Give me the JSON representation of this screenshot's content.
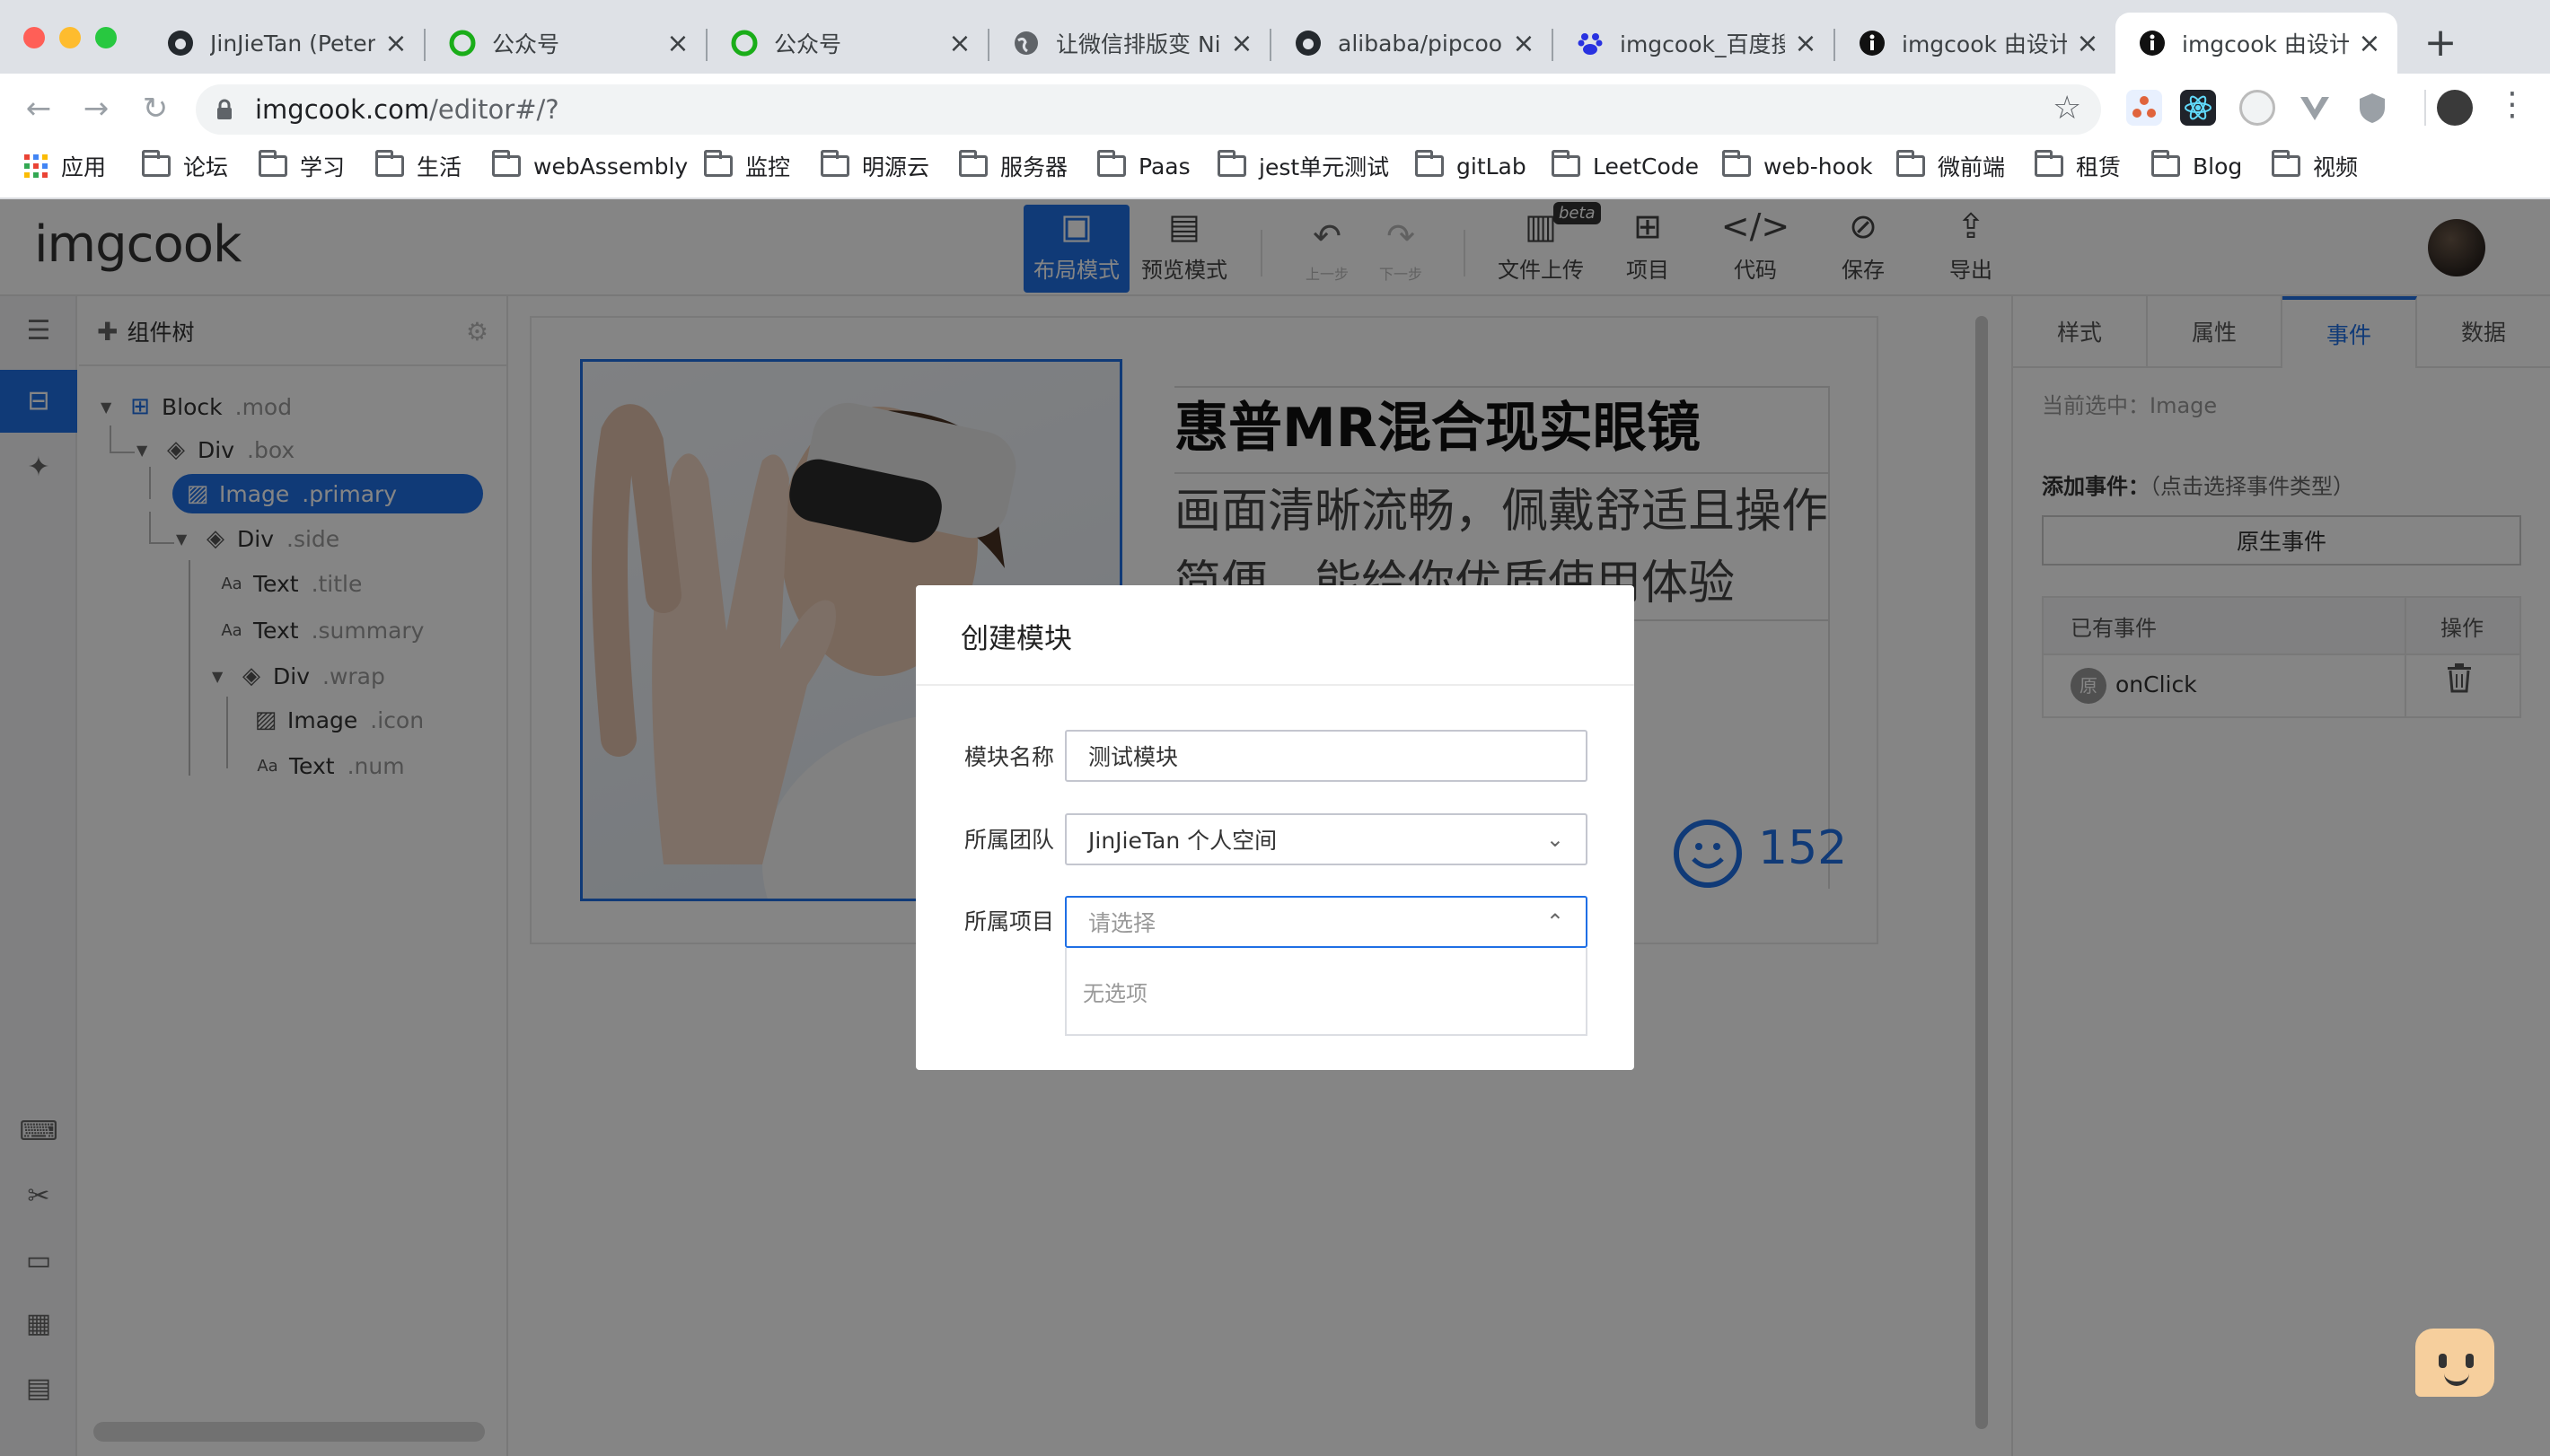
{
  "browser": {
    "tabs": [
      {
        "label": "JinJieTan (Peter)",
        "favicon": "github-icon"
      },
      {
        "label": "公众号",
        "favicon": "wechat-mp-icon"
      },
      {
        "label": "公众号",
        "favicon": "wechat-mp-icon"
      },
      {
        "label": "让微信排版变 Ni",
        "favicon": "globe-icon"
      },
      {
        "label": "alibaba/pipcook",
        "favicon": "github-icon"
      },
      {
        "label": "imgcook_百度搜",
        "favicon": "baidu-icon"
      },
      {
        "label": "imgcook 由设计",
        "favicon": "info-icon"
      },
      {
        "label": "imgcook 由设计",
        "favicon": "info-icon",
        "active": true
      }
    ],
    "url_host": "imgcook.com",
    "url_path": "/editor#/?",
    "bookmarks": [
      "应用",
      "论坛",
      "学习",
      "生活",
      "webAssembly",
      "监控",
      "明源云",
      "服务器",
      "Paas",
      "jest单元测试",
      "gitLab",
      "LeetCode",
      "web-hook",
      "微前端",
      "租赁",
      "Blog",
      "视频"
    ]
  },
  "app": {
    "logo": "imgcook",
    "toolbar": {
      "layout_mode": "布局模式",
      "preview_mode": "预览模式",
      "undo": "上一步",
      "redo": "下一步",
      "upload": "文件上传",
      "upload_badge": "beta",
      "project": "项目",
      "code": "代码",
      "save": "保存",
      "export": "导出"
    },
    "tree": {
      "title": "组件树",
      "nodes": [
        {
          "tag": "Block",
          "cls": ".mod"
        },
        {
          "tag": "Div",
          "cls": ".box"
        },
        {
          "tag": "Image",
          "cls": ".primary"
        },
        {
          "tag": "Div",
          "cls": ".side"
        },
        {
          "tag": "Text",
          "cls": ".title"
        },
        {
          "tag": "Text",
          "cls": ".summary"
        },
        {
          "tag": "Div",
          "cls": ".wrap"
        },
        {
          "tag": "Image",
          "cls": ".icon"
        },
        {
          "tag": "Text",
          "cls": ".num"
        }
      ]
    },
    "canvas": {
      "title": "惠普MR混合现实眼镜",
      "summary": "画面清晰流畅，佩戴舒适且操作简便，能给你优质使用体验",
      "num": "152"
    },
    "right_panel": {
      "tabs": [
        "样式",
        "属性",
        "事件",
        "数据"
      ],
      "current_selection": "当前选中：Image",
      "add_event_label": "添加事件：",
      "add_event_hint": "（点击选择事件类型）",
      "native_event_button": "原生事件",
      "table_header_events": "已有事件",
      "table_header_ops": "操作",
      "event_badge": "原",
      "event_name": "onClick"
    }
  },
  "modal": {
    "title": "创建模块",
    "name_label": "模块名称",
    "name_value": "测试模块",
    "team_label": "所属团队",
    "team_value": "JinJieTan 个人空间",
    "project_label": "所属项目",
    "project_placeholder": "请选择",
    "no_options": "无选项"
  }
}
